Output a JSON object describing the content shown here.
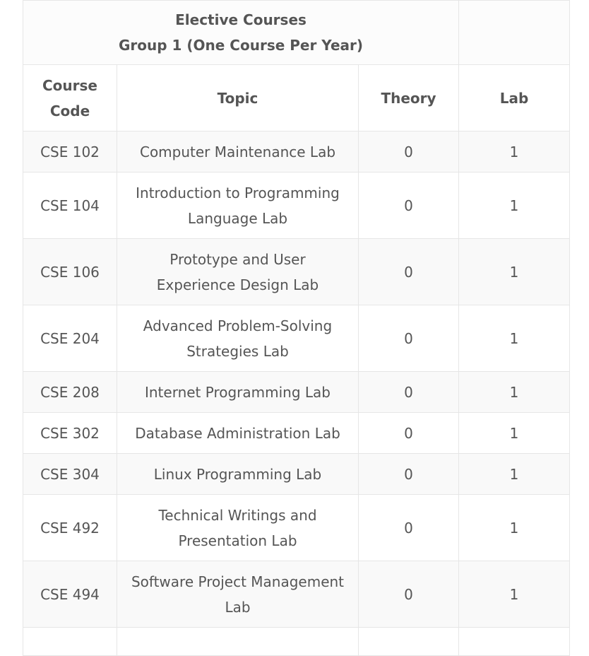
{
  "table": {
    "group_title": "Elective Courses",
    "group_subtitle": "Group 1 (One Course Per Year)",
    "columns": [
      "Course Code",
      "Topic",
      "Theory",
      "Lab"
    ],
    "rows": [
      {
        "code": "CSE 102",
        "topic": "Computer Maintenance Lab",
        "theory": "0",
        "lab": "1"
      },
      {
        "code": "CSE 104",
        "topic": "Introduction to Programming Language Lab",
        "theory": "0",
        "lab": "1"
      },
      {
        "code": "CSE 106",
        "topic": "Prototype and User Experience Design Lab",
        "theory": "0",
        "lab": "1"
      },
      {
        "code": "CSE 204",
        "topic": "Advanced Problem-Solving Strategies Lab",
        "theory": "0",
        "lab": "1"
      },
      {
        "code": "CSE 208",
        "topic": "Internet Programming Lab",
        "theory": "0",
        "lab": "1"
      },
      {
        "code": "CSE 302",
        "topic": "Database Administration Lab",
        "theory": "0",
        "lab": "1"
      },
      {
        "code": "CSE 304",
        "topic": "Linux Programming Lab",
        "theory": "0",
        "lab": "1"
      },
      {
        "code": "CSE 492",
        "topic": "Technical Writings and Presentation Lab",
        "theory": "0",
        "lab": "1"
      },
      {
        "code": "CSE 494",
        "topic": "Software Project Management Lab",
        "theory": "0",
        "lab": "1"
      }
    ]
  }
}
